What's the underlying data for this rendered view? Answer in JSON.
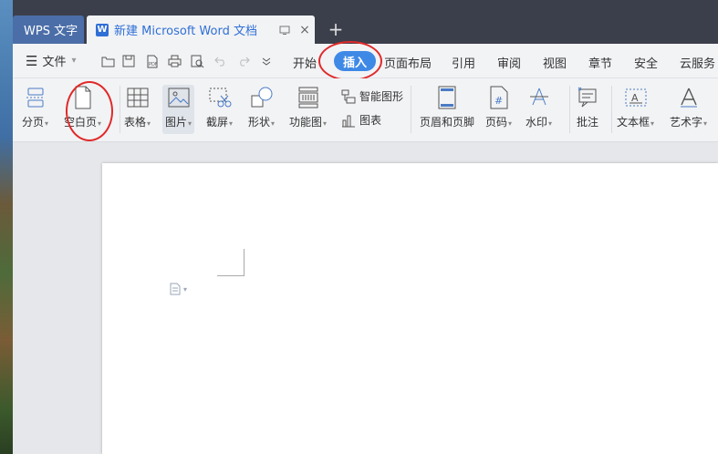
{
  "tabs": {
    "wps": "WPS 文字",
    "doc": "新建 Microsoft Word 文档",
    "doc_icon_letter": "W"
  },
  "menu": {
    "file": "文件",
    "tabs": [
      "开始",
      "插入",
      "页面布局",
      "引用",
      "审阅",
      "视图",
      "章节",
      "安全",
      "云服务"
    ],
    "active_tab": "插入"
  },
  "ribbon": {
    "page_break": "分页",
    "blank_page": "空白页",
    "table": "表格",
    "picture": "图片",
    "screenshot": "截屏",
    "shape": "形状",
    "function_chart": "功能图",
    "smart_shape": "智能图形",
    "chart": "图表",
    "header_footer": "页眉和页脚",
    "page_number": "页码",
    "watermark": "水印",
    "comment": "批注",
    "text_box": "文本框",
    "word_art": "艺术字"
  },
  "colors": {
    "accent": "#3f89e6",
    "annotation": "#e02a2a",
    "wps_tab": "#4b6ea8"
  },
  "icons": {
    "close": "×",
    "new_tab": "+",
    "menu": "☰",
    "dropdown": "▾"
  }
}
